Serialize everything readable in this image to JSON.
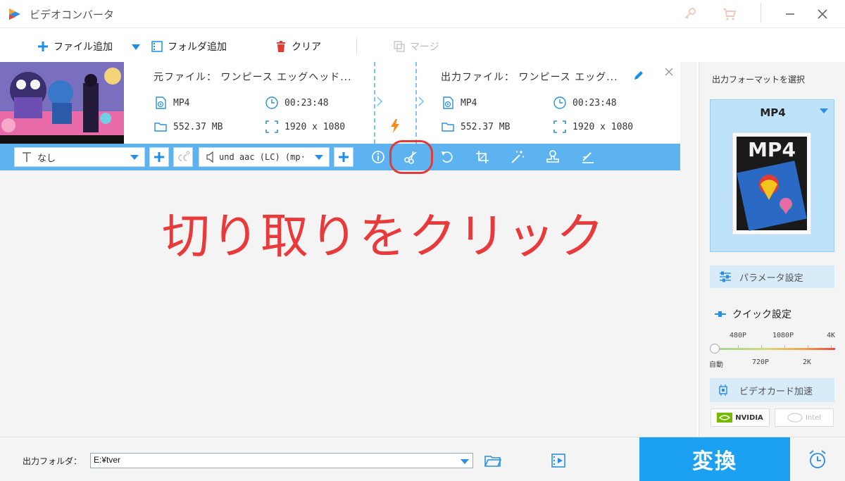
{
  "app": {
    "title": "ビデオコンバータ"
  },
  "toolbar": {
    "add_file": "ファイル追加",
    "add_folder": "フォルダ追加",
    "clear": "クリア",
    "merge": "マージ"
  },
  "file": {
    "source_label": "元ファイル： ワンピース エッグヘッド...",
    "output_label": "出力ファイル： ワンピース エッグ...",
    "source": {
      "format": "MP4",
      "duration": "00:23:48",
      "size": "552.37 MB",
      "resolution": "1920 x 1080"
    },
    "output": {
      "format": "MP4",
      "duration": "00:23:48",
      "size": "552.37 MB",
      "resolution": "1920 x 1080"
    }
  },
  "editbar": {
    "subtitle_value": "なし",
    "audio_value": "und aac (LC) (mp·"
  },
  "annotation": {
    "text": "切り取りをクリック"
  },
  "right_panel": {
    "title": "出力フォーマットを選択",
    "format_name": "MP4",
    "format_badge": "MP4",
    "param_button": "パラメータ設定",
    "quick_title": "クイック設定",
    "quality_labels_top": [
      "480P",
      "1080P",
      "4K"
    ],
    "quality_labels_bottom": [
      "自動",
      "720P",
      "2K"
    ],
    "gpu_button": "ビデオカード加速",
    "vendor_nvidia": "NVIDIA",
    "vendor_intel": "Intel"
  },
  "bottom": {
    "output_folder_label": "出力フォルダ：",
    "output_folder_path": "E:¥tver",
    "convert_button": "変換"
  },
  "colors": {
    "accent": "#1ca0f2",
    "editbar": "#5db3ef",
    "annotation": "#e8393b",
    "format_card": "#bfe2fb"
  }
}
